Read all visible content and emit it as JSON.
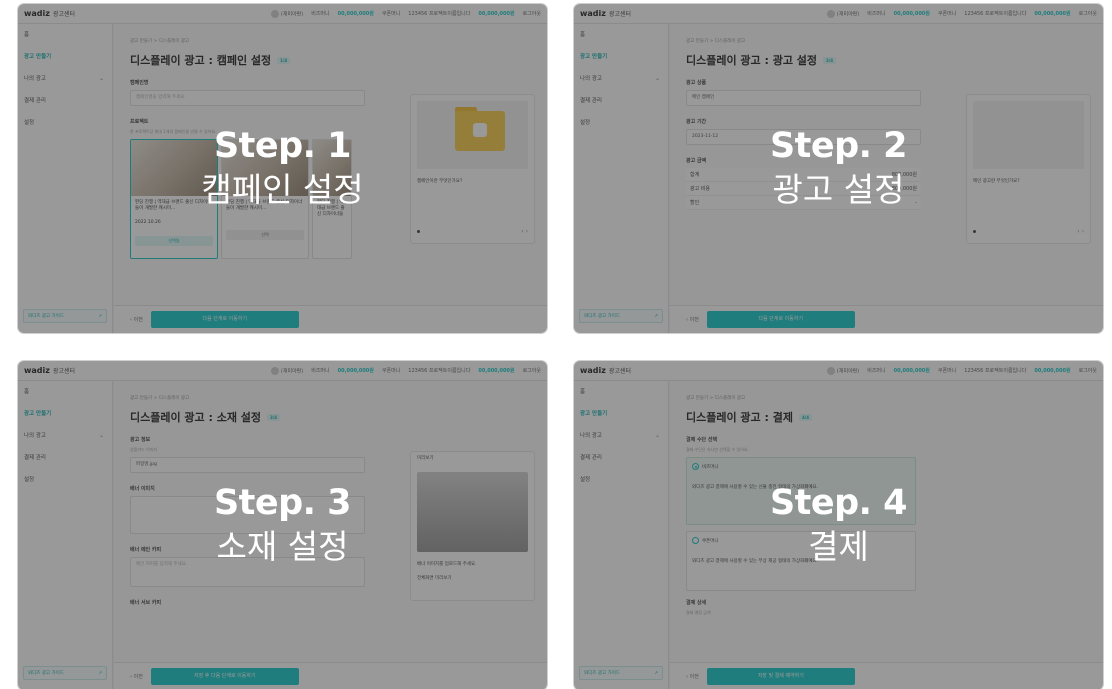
{
  "common": {
    "logo": "wadiz",
    "logo_sub": "광고센터",
    "topbar_user": "(재미야편)",
    "topbar_money_label": "비즈머니",
    "topbar_money_value": "00,000,000원",
    "topbar_coupon": "쿠폰머니",
    "topbar_project": "123456 프로젝트이름입니다",
    "topbar_project_value": "00,000,000원",
    "topbar_logout": "로그아웃",
    "sidebar_items": [
      "홈",
      "광고 만들기",
      "나의 광고",
      "결제 관리",
      "설정"
    ],
    "sidebar_bottom": "와디즈 광고 가이드",
    "breadcrumb": "광고 만들기 > 디스플레이 광고",
    "prev_label": "이전"
  },
  "panels": [
    {
      "step_label": "Step. 1",
      "step_title": "캠페인 설정",
      "page_title": "디스플레이 광고 : 캠페인 설정",
      "badge": "1/4",
      "field1_label": "캠페인명",
      "field1_placeholder": "캠페인명을 입력해 주세요.",
      "field2_label": "프로젝트",
      "field2_hint": "한 프로젝트당 최대 1개의 캠페인을 만들 수 있어요.",
      "cards": [
        {
          "title": "펀딩 진행 | 역대급 브랜드 출신 디자이너들이 개발한 캐시미...",
          "date": "2022.10.26",
          "button": "선택됨"
        },
        {
          "title": "펀딩 진행 | 역대급 브랜드 출신 디자이너들이 개발한 캐시미...",
          "date": "",
          "button": "선택"
        },
        {
          "title": "펀딩 진행 | 역대급 브랜드 출신 디자이너들",
          "date": "",
          "button": ""
        }
      ],
      "preview_caption": "캠페인이란 무엇인가요?",
      "preview_tag": "캠페인",
      "next_label": "다음 단계로 이동하기"
    },
    {
      "step_label": "Step. 2",
      "step_title": "광고 설정",
      "page_title": "디스플레이 광고 : 광고 설정",
      "badge": "2/4",
      "field1_label": "광고 상품",
      "field1_value": "메인 캠페인",
      "field2_label": "광고 기간",
      "field2_value": "2023-11-12",
      "field3_label": "광고 금액",
      "rows": [
        {
          "k": "합계",
          "v": "800,000원"
        },
        {
          "k": "광고 비용",
          "v": "800,000원"
        },
        {
          "k": "할인",
          "v": "-"
        }
      ],
      "preview_caption": "메인 광고란 무엇인가요?",
      "next_label": "다음 단계로 이동하기"
    },
    {
      "step_label": "Step. 3",
      "step_title": "소재 설정",
      "page_title": "디스플레이 광고 : 소재 설정",
      "badge": "3/4",
      "field1_label": "광고 정보",
      "field1_sub": "상품카드 이미지",
      "field1_value": "파일명.jpg",
      "field2_label": "배너 이미지",
      "field3_label": "배너 메인 카피",
      "field3_placeholder": "메인 카피를 입력해 주세요.",
      "field4_label": "배너 서브 카피",
      "preview_title": "미리보기",
      "preview_caption": "배너 이미지를 업로드해 주세요.",
      "preview_button": "전체화면 미리보기",
      "next_label": "저장 후 다음 단계로 이동하기"
    },
    {
      "step_label": "Step. 4",
      "step_title": "결제",
      "page_title": "디스플레이 광고 : 결제",
      "badge": "4/4",
      "field1_label": "결제 수단 선택",
      "field1_hint": "결제 수단은 하나만 선택할 수 있어요.",
      "opt1": "비즈머니",
      "opt1_text": "와디즈 광고 결제에 사용할 수 있는 선불 충전 형태의 가상화폐예요.",
      "opt2": "쿠폰머니",
      "opt2_text": "와디즈 광고 결제에 사용할 수 있는 무상 제공 형태의 가상화폐예요.",
      "detail_label": "결제 상세",
      "detail_sub": "결제 예정 금액",
      "next_label": "저장 및 결제 예약하기"
    }
  ]
}
